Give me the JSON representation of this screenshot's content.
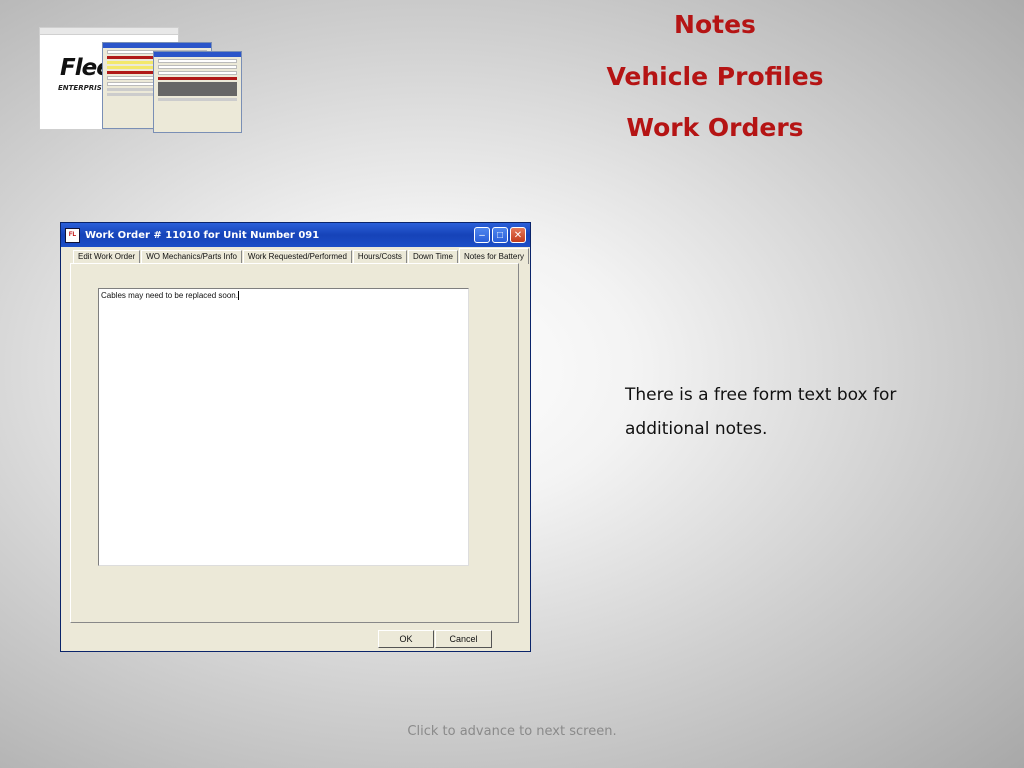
{
  "slide": {
    "headings": [
      "Notes",
      "Vehicle Profiles",
      "Work Orders"
    ],
    "description": "There is a free form text box for additional notes.",
    "footer": "Click to advance to next screen."
  },
  "logo": {
    "text": "Flee",
    "subtext": "ENTERPRISE E"
  },
  "window": {
    "title": "Work Order # 11010 for Unit Number 091",
    "tabs": [
      "Edit Work Order",
      "WO Mechanics/Parts Info",
      "Work Requested/Performed",
      "Hours/Costs",
      "Down Time",
      "Notes for Battery"
    ],
    "active_tab": "Notes for Battery",
    "notes_value": "Cables may need to be replaced soon.",
    "ok_label": "OK",
    "cancel_label": "Cancel"
  },
  "colors": {
    "heading": "#b51414",
    "titlebar": "#1643b8",
    "window_bg": "#ece9d8"
  }
}
